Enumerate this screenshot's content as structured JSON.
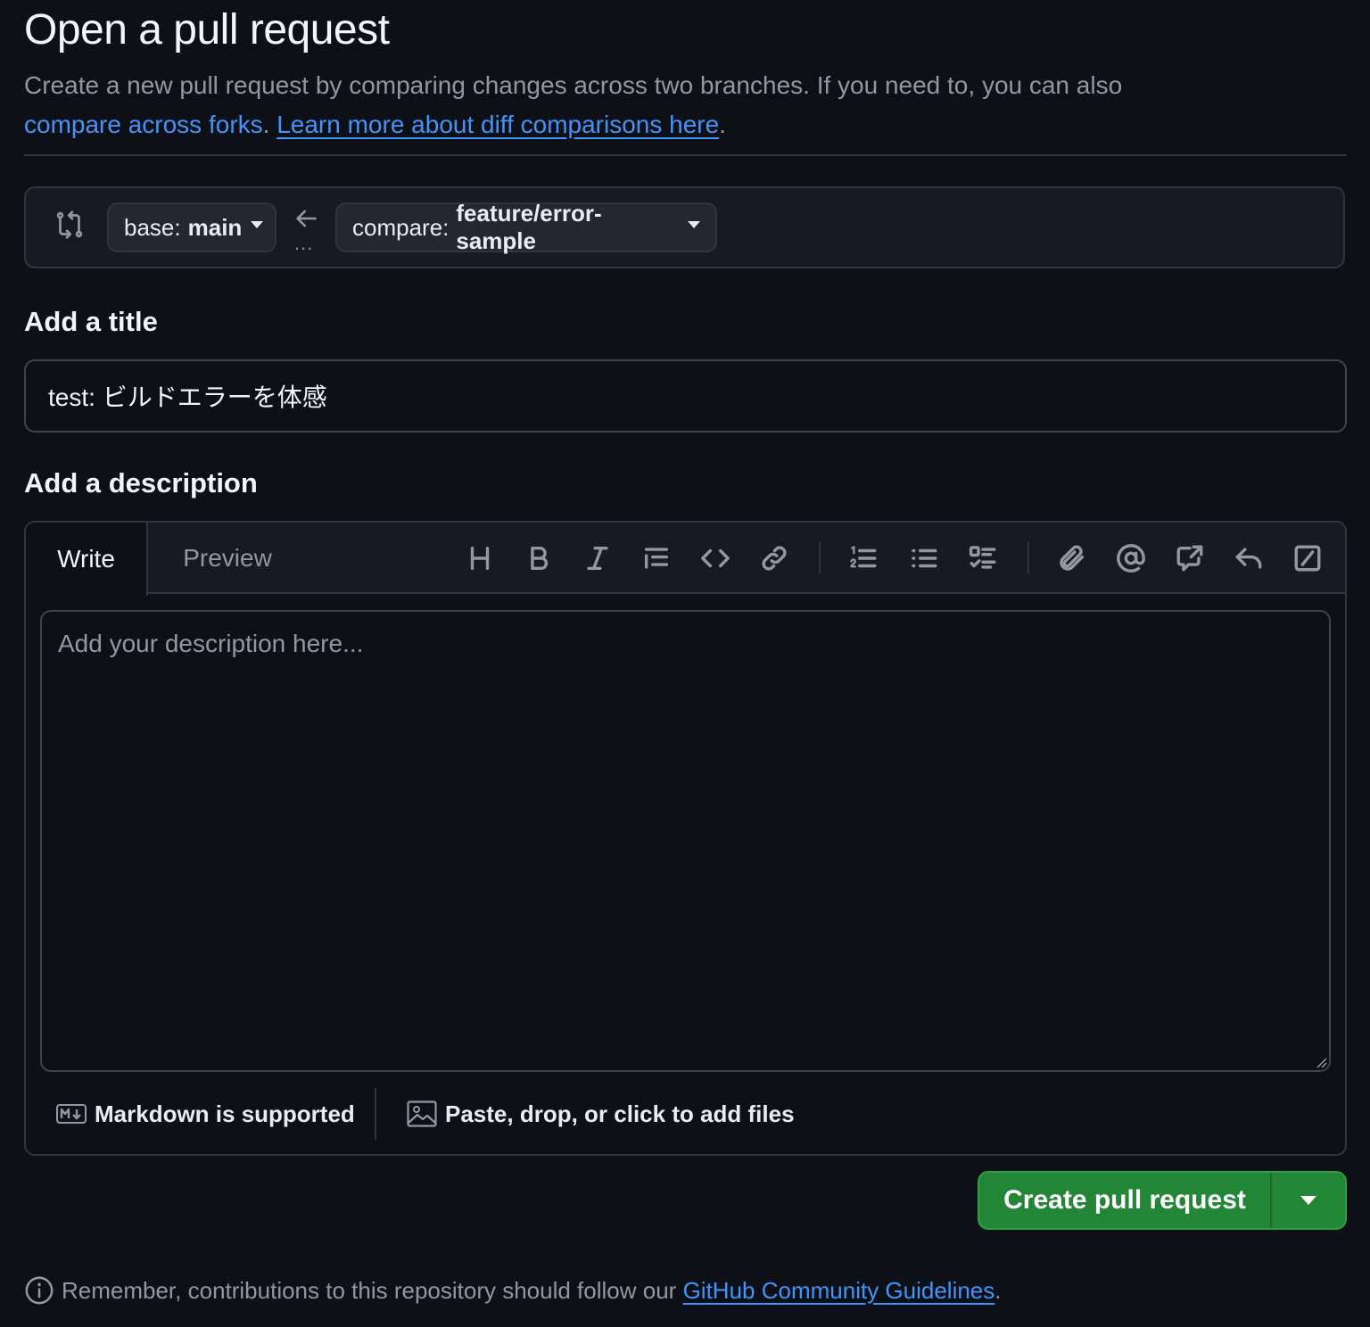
{
  "page": {
    "title": "Open a pull request",
    "intro_text": "Create a new pull request by comparing changes across two branches. If you need to, you can also",
    "compare_forks_link": "compare across forks",
    "learn_more_link": "Learn more about diff comparisons here"
  },
  "range": {
    "base_prefix": "base:",
    "base_value": "main",
    "compare_prefix": "compare:",
    "compare_value": "feature/error-sample",
    "dots": "..."
  },
  "title_section": {
    "label": "Add a title",
    "value": "test: ビルドエラーを体感"
  },
  "description_section": {
    "label": "Add a description",
    "tabs": [
      "Write",
      "Preview"
    ],
    "active_tab": "Write",
    "placeholder": "Add your description here...",
    "toolbar_icons": [
      "heading-icon",
      "bold-icon",
      "italic-icon",
      "quote-icon",
      "code-icon",
      "link-icon",
      "ordered-list-icon",
      "unordered-list-icon",
      "task-list-icon",
      "attach-icon",
      "mention-icon",
      "reference-icon",
      "saved-reply-icon",
      "slash-command-icon"
    ],
    "markdown_note": "Markdown is supported",
    "files_note": "Paste, drop, or click to add files"
  },
  "actions": {
    "create_label": "Create pull request",
    "create_color": "#238636"
  },
  "footer": {
    "reminder_text": "Remember, contributions to this repository should follow our",
    "guidelines_link": "GitHub Community Guidelines"
  },
  "colors": {
    "background": "#0d1117",
    "link": "#4493f8",
    "border": "#30363d"
  }
}
